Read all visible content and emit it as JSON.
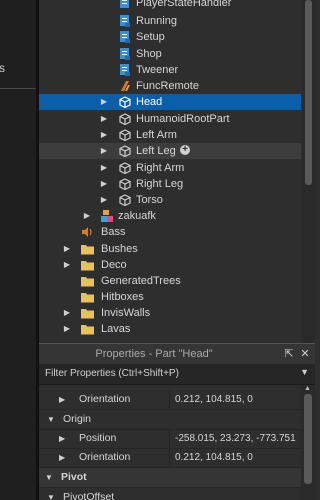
{
  "left_pane": {
    "cut_text": "s"
  },
  "explorer": {
    "items": [
      {
        "label": "PlayerStateHandler",
        "icon": "script-icon",
        "color": "#3a8fd9"
      },
      {
        "label": "Running",
        "icon": "script-icon",
        "color": "#3a8fd9"
      },
      {
        "label": "Setup",
        "icon": "script-icon",
        "color": "#3a8fd9"
      },
      {
        "label": "Shop",
        "icon": "script-icon",
        "color": "#3a8fd9"
      },
      {
        "label": "Tweener",
        "icon": "script-icon",
        "color": "#3a8fd9"
      },
      {
        "label": "FuncRemote",
        "icon": "remote-function-icon",
        "color": "#e0781e"
      },
      {
        "label": "Head",
        "icon": "part-icon",
        "color": "#cfcfcf"
      },
      {
        "label": "HumanoidRootPart",
        "icon": "part-icon",
        "color": "#cfcfcf"
      },
      {
        "label": "Left Arm",
        "icon": "part-icon",
        "color": "#cfcfcf"
      },
      {
        "label": "Left Leg",
        "icon": "part-icon",
        "color": "#cfcfcf"
      },
      {
        "label": "Right Arm",
        "icon": "part-icon",
        "color": "#cfcfcf"
      },
      {
        "label": "Right Leg",
        "icon": "part-icon",
        "color": "#cfcfcf"
      },
      {
        "label": "Torso",
        "icon": "part-icon",
        "color": "#cfcfcf"
      },
      {
        "label": "zakuafk",
        "icon": "model-icon",
        "color": "#3aa0e0"
      },
      {
        "label": "Bass",
        "icon": "sound-icon",
        "color": "#e0781e"
      },
      {
        "label": "Bushes",
        "icon": "folder-icon",
        "color": "#e8c15a"
      },
      {
        "label": "Deco",
        "icon": "folder-icon",
        "color": "#e8c15a"
      },
      {
        "label": "GeneratedTrees",
        "icon": "folder-icon",
        "color": "#e8c15a"
      },
      {
        "label": "Hitboxes",
        "icon": "folder-icon",
        "color": "#e8c15a"
      },
      {
        "label": "InvisWalls",
        "icon": "folder-icon",
        "color": "#e8c15a"
      },
      {
        "label": "Lavas",
        "icon": "folder-icon",
        "color": "#e8c15a"
      }
    ]
  },
  "properties": {
    "title": "Properties - Part \"Head\"",
    "filter_placeholder": "Filter Properties (Ctrl+Shift+P)",
    "rows": [
      {
        "name": "Orientation",
        "value": "0.212, 104.815, 0",
        "kind": "sub"
      },
      {
        "name": "Origin",
        "value": "",
        "kind": "group"
      },
      {
        "name": "Position",
        "value": "-258.015, 23.273, -773.751",
        "kind": "sub"
      },
      {
        "name": "Orientation",
        "value": "0.212, 104.815, 0",
        "kind": "sub"
      },
      {
        "name": "Pivot",
        "value": "",
        "kind": "category"
      },
      {
        "name": "PivotOffset",
        "value": "",
        "kind": "group"
      }
    ]
  }
}
